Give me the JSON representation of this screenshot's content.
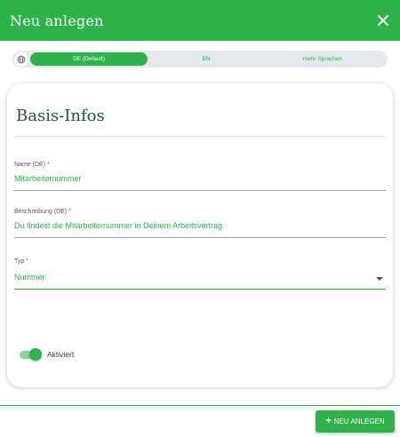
{
  "dialog": {
    "title": "Neu anlegen"
  },
  "languages": {
    "tabs": [
      {
        "label": "DE (Default)",
        "active": true
      },
      {
        "label": "EN",
        "active": false
      },
      {
        "label": "mehr Sprachen",
        "active": false
      }
    ]
  },
  "card": {
    "title": "Basis-Infos",
    "fields": {
      "name": {
        "label": "Name (DE)",
        "required_mark": "*",
        "value": "Mitarbeiternummer"
      },
      "description": {
        "label": "Beschreibung (DE)",
        "required_mark": "*",
        "value": "Du findest die Mitarbeiternummer in Deinem Arbeitsvertrag"
      },
      "type": {
        "label": "Typ",
        "required_mark": "*",
        "value": "Nummer"
      }
    },
    "toggle": {
      "label": "Aktiviert",
      "on": true
    }
  },
  "footer": {
    "create_label": "NEU ANLEGEN"
  },
  "colors": {
    "primary": "#2db34a",
    "title": "#1f4f52",
    "required": "#e53935"
  },
  "icons": [
    "close-icon",
    "globe-icon",
    "chevron-down-icon",
    "plus-icon"
  ]
}
